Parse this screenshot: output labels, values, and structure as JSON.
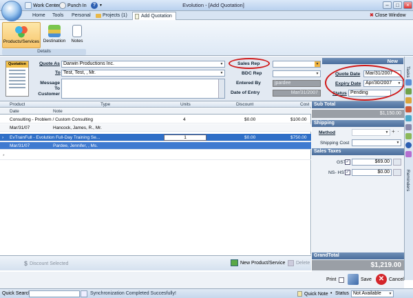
{
  "titlebar": {
    "title": "Evolution - [Add Quotation]",
    "work_center": "Work Center",
    "punch_in": "Punch In",
    "help": "?"
  },
  "tabs": [
    {
      "label": "Home"
    },
    {
      "label": "Tools"
    },
    {
      "label": "Personal"
    },
    {
      "label": "Projects (1)"
    },
    {
      "label": "Add Quotation"
    }
  ],
  "close_window": "Close Window",
  "ribbon": {
    "buttons": [
      {
        "label": "Products/Services"
      },
      {
        "label": "Destination"
      },
      {
        "label": "Notes"
      }
    ],
    "group_label": "Details"
  },
  "form": {
    "doc_label": "Quotation",
    "quote_as_label": "Quote As",
    "quote_as_value": "Darwin Productions Inc.",
    "to_label": "To",
    "to_value": "Test, Test, , Mr.",
    "message_label": "Message To Customer",
    "message_value": "",
    "sales_rep_label": "Sales Rep",
    "sales_rep_value": "",
    "bdc_rep_label": "BDC Rep",
    "bdc_rep_value": "",
    "entered_by_label": "Entered By",
    "entered_by_value": "jpardee",
    "date_of_entry_label": "Date of Entry",
    "date_of_entry_value": "Mar/31/2007",
    "status_header": "New",
    "quote_date_label": "Quote Date",
    "quote_date_value": "Mar/31/2007",
    "expiry_date_label": "Expiry Date",
    "expiry_date_value": "Apr/30/2007",
    "status_label": "Status",
    "status_value": "Pending"
  },
  "grid": {
    "headers": {
      "product": "Product",
      "type": "Type",
      "units": "Units",
      "discount": "Discount",
      "cost": "Cost",
      "date": "Date",
      "note": "Note"
    },
    "rows": [
      {
        "product": "Consulting - Problem / Custom Consulting",
        "units": "4",
        "discount": "$0.00",
        "cost": "$100.00",
        "date": "Mar/31/07",
        "note": "Hancock, James, R., Mr."
      },
      {
        "product": "EvTrainFull - Evolution Full-Day Training Se...",
        "units": "1",
        "discount": "$0.00",
        "cost": "$750.00",
        "date": "Mar/31/07",
        "note": "Pardee, Jennifer, , Ms."
      }
    ],
    "discount_selected": "Discount Selected",
    "new_product": "New Product/Service",
    "delete": "Delete"
  },
  "totals": {
    "sub_total_label": "Sub Total",
    "sub_total_value": "$1,150.00",
    "shipping_label": "Shipping",
    "method_label": "Method",
    "shipping_cost_label": "Shipping Cost",
    "sales_taxes_label": "Sales Taxes",
    "gst_label": "GST",
    "gst_value": "$69.00",
    "nshst_label": "NS- HST",
    "nshst_value": "$0.00",
    "grand_total_label": "GrandTotal",
    "grand_total_value": "$1,219.00"
  },
  "sidebar": {
    "tasks": "Tasks",
    "reminders": "Reminders"
  },
  "actions": {
    "print": "Print",
    "save": "Save",
    "cancel": "Cancel"
  },
  "status": {
    "quick_search": "Quick Search",
    "sync_message": "Synchronization Completed Succesfully!",
    "quick_note": "Quick Note",
    "status_label": "Status",
    "status_value": "Not Available"
  },
  "colors": {
    "selected_row": "#2f6fc7",
    "annotation": "#d01818",
    "section_header": "#4b6e9c"
  }
}
